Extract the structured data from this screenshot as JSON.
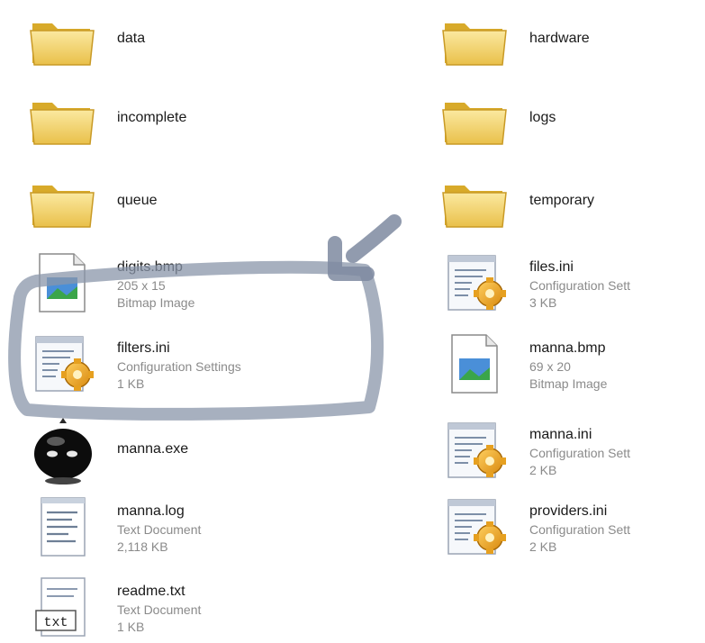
{
  "colors": {
    "folder": "#f2d36b",
    "folder_dark": "#d8aa2a",
    "highlight": "#8a96aa"
  },
  "left_column": [
    {
      "name": "data",
      "type": "folder"
    },
    {
      "name": "incomplete",
      "type": "folder"
    },
    {
      "name": "queue",
      "type": "folder"
    },
    {
      "name": "digits.bmp",
      "type": "bitmap",
      "line2": "205 x 15",
      "line3": "Bitmap Image"
    },
    {
      "name": "filters.ini",
      "type": "config",
      "line2": "Configuration Settings",
      "line3": "1 KB"
    },
    {
      "name": "manna.exe",
      "type": "exe"
    },
    {
      "name": "manna.log",
      "type": "text",
      "line2": "Text Document",
      "line3": "2,118 KB"
    },
    {
      "name": "readme.txt",
      "type": "txt",
      "line2": "Text Document",
      "line3": "1 KB"
    }
  ],
  "right_column": [
    {
      "name": "hardware",
      "type": "folder"
    },
    {
      "name": "logs",
      "type": "folder"
    },
    {
      "name": "temporary",
      "type": "folder"
    },
    {
      "name": "files.ini",
      "type": "config",
      "line2": "Configuration Sett",
      "line3": "3 KB"
    },
    {
      "name": "manna.bmp",
      "type": "bitmap",
      "line2": "69 x 20",
      "line3": "Bitmap Image"
    },
    {
      "name": "manna.ini",
      "type": "config",
      "line2": "Configuration Sett",
      "line3": "2 KB"
    },
    {
      "name": "providers.ini",
      "type": "config",
      "line2": "Configuration Sett",
      "line3": "2 KB"
    }
  ]
}
